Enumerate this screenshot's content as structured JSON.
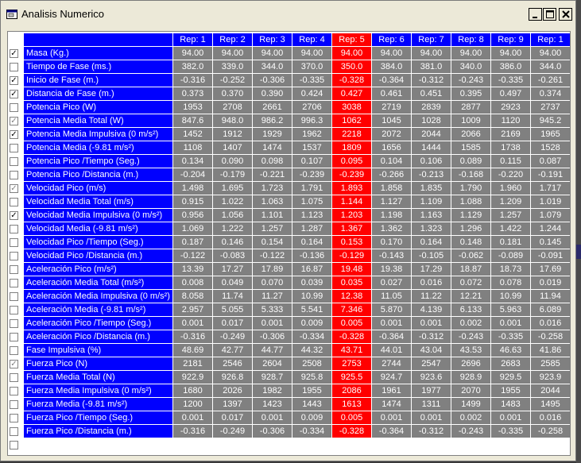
{
  "window": {
    "title": "Analisis Numerico"
  },
  "columns": [
    "Rep: 1",
    "Rep: 2",
    "Rep: 3",
    "Rep: 4",
    "Rep: 5",
    "Rep: 6",
    "Rep: 7",
    "Rep: 8",
    "Rep: 9",
    "Rep: 1"
  ],
  "selected_column": 4,
  "rows": [
    {
      "label": "Masa (Kg.)",
      "check": "checked",
      "values": [
        "94.00",
        "94.00",
        "94.00",
        "94.00",
        "94.00",
        "94.00",
        "94.00",
        "94.00",
        "94.00",
        "94.00"
      ]
    },
    {
      "label": "Tiempo de Fase (ms.)",
      "check": "unchecked",
      "values": [
        "382.0",
        "339.0",
        "344.0",
        "370.0",
        "350.0",
        "384.0",
        "381.0",
        "340.0",
        "386.0",
        "344.0"
      ]
    },
    {
      "label": "Inicio de Fase (m.)",
      "check": "checked",
      "values": [
        "-0.316",
        "-0.252",
        "-0.306",
        "-0.335",
        "-0.328",
        "-0.364",
        "-0.312",
        "-0.243",
        "-0.335",
        "-0.261"
      ]
    },
    {
      "label": "Distancia de Fase (m.)",
      "check": "checked",
      "values": [
        "0.373",
        "0.370",
        "0.390",
        "0.424",
        "0.427",
        "0.461",
        "0.451",
        "0.395",
        "0.497",
        "0.374"
      ]
    },
    {
      "label": "Potencia Pico (W)",
      "check": "unchecked",
      "values": [
        "1953",
        "2708",
        "2661",
        "2706",
        "3038",
        "2719",
        "2839",
        "2877",
        "2923",
        "2737"
      ]
    },
    {
      "label": "Potencia Media Total (W)",
      "check": "checked-gray",
      "values": [
        "847.6",
        "948.0",
        "986.2",
        "996.3",
        "1062",
        "1045",
        "1028",
        "1009",
        "1120",
        "945.2"
      ]
    },
    {
      "label": "Potencia Media Impulsiva (0 m/s²)",
      "check": "checked",
      "values": [
        "1452",
        "1912",
        "1929",
        "1962",
        "2218",
        "2072",
        "2044",
        "2066",
        "2169",
        "1965"
      ]
    },
    {
      "label": "Potencia Media (-9.81 m/s²)",
      "check": "unchecked",
      "values": [
        "1108",
        "1407",
        "1474",
        "1537",
        "1809",
        "1656",
        "1444",
        "1585",
        "1738",
        "1528"
      ]
    },
    {
      "label": "Potencia Pico /Tiempo (Seg.)",
      "check": "unchecked",
      "values": [
        "0.134",
        "0.090",
        "0.098",
        "0.107",
        "0.095",
        "0.104",
        "0.106",
        "0.089",
        "0.115",
        "0.087"
      ]
    },
    {
      "label": "Potencia Pico /Distancia (m.)",
      "check": "unchecked",
      "values": [
        "-0.204",
        "-0.179",
        "-0.221",
        "-0.239",
        "-0.239",
        "-0.266",
        "-0.213",
        "-0.168",
        "-0.220",
        "-0.191"
      ]
    },
    {
      "label": "Velocidad Pico (m/s)",
      "check": "checked-gray",
      "values": [
        "1.498",
        "1.695",
        "1.723",
        "1.791",
        "1.893",
        "1.858",
        "1.835",
        "1.790",
        "1.960",
        "1.717"
      ]
    },
    {
      "label": "Velocidad Media Total (m/s)",
      "check": "unchecked",
      "values": [
        "0.915",
        "1.022",
        "1.063",
        "1.075",
        "1.144",
        "1.127",
        "1.109",
        "1.088",
        "1.209",
        "1.019"
      ]
    },
    {
      "label": "Velocidad Media Impulsiva (0 m/s²)",
      "check": "checked",
      "values": [
        "0.956",
        "1.056",
        "1.101",
        "1.123",
        "1.203",
        "1.198",
        "1.163",
        "1.129",
        "1.257",
        "1.079"
      ]
    },
    {
      "label": "Velocidad Media (-9.81 m/s²)",
      "check": "unchecked",
      "values": [
        "1.069",
        "1.222",
        "1.257",
        "1.287",
        "1.367",
        "1.362",
        "1.323",
        "1.296",
        "1.422",
        "1.244"
      ]
    },
    {
      "label": "Velocidad Pico /Tiempo (Seg.)",
      "check": "unchecked",
      "values": [
        "0.187",
        "0.146",
        "0.154",
        "0.164",
        "0.153",
        "0.170",
        "0.164",
        "0.148",
        "0.181",
        "0.145"
      ]
    },
    {
      "label": "Velocidad Pico /Distancia (m.)",
      "check": "unchecked",
      "values": [
        "-0.122",
        "-0.083",
        "-0.122",
        "-0.136",
        "-0.129",
        "-0.143",
        "-0.105",
        "-0.062",
        "-0.089",
        "-0.091"
      ]
    },
    {
      "label": "Aceleración Pico (m/s²)",
      "check": "unchecked",
      "values": [
        "13.39",
        "17.27",
        "17.89",
        "16.87",
        "19.48",
        "19.38",
        "17.29",
        "18.87",
        "18.73",
        "17.69"
      ]
    },
    {
      "label": "Aceleración Media Total (m/s²)",
      "check": "unchecked",
      "values": [
        "0.008",
        "0.049",
        "0.070",
        "0.039",
        "0.035",
        "0.027",
        "0.016",
        "0.072",
        "0.078",
        "0.019"
      ]
    },
    {
      "label": "Aceleración Media Impulsiva (0 m/s²)",
      "check": "unchecked",
      "values": [
        "8.058",
        "11.74",
        "11.27",
        "10.99",
        "12.38",
        "11.05",
        "11.22",
        "12.21",
        "10.99",
        "11.94"
      ]
    },
    {
      "label": "Aceleración Media (-9.81 m/s²)",
      "check": "unchecked",
      "values": [
        "2.957",
        "5.055",
        "5.333",
        "5.541",
        "7.346",
        "5.870",
        "4.139",
        "6.133",
        "5.963",
        "6.089"
      ]
    },
    {
      "label": "Aceleración Pico /Tiempo (Seg.)",
      "check": "unchecked",
      "values": [
        "0.001",
        "0.017",
        "0.001",
        "0.009",
        "0.005",
        "0.001",
        "0.001",
        "0.002",
        "0.001",
        "0.016"
      ]
    },
    {
      "label": "Aceleración Pico /Distancia (m.)",
      "check": "unchecked",
      "values": [
        "-0.316",
        "-0.249",
        "-0.306",
        "-0.334",
        "-0.328",
        "-0.364",
        "-0.312",
        "-0.243",
        "-0.335",
        "-0.258"
      ]
    },
    {
      "label": "Fase Impulsiva (%)",
      "check": "unchecked",
      "values": [
        "48.69",
        "42.77",
        "44.77",
        "44.32",
        "43.71",
        "44.01",
        "43.04",
        "43.53",
        "46.63",
        "41.86"
      ]
    },
    {
      "label": "Fuerza Pico (N)",
      "check": "checked-gray",
      "values": [
        "2181",
        "2546",
        "2604",
        "2508",
        "2753",
        "2744",
        "2547",
        "2696",
        "2683",
        "2585"
      ]
    },
    {
      "label": "Fuerza Media Total (N)",
      "check": "unchecked",
      "values": [
        "922.9",
        "926.8",
        "928.7",
        "925.8",
        "925.5",
        "924.7",
        "923.6",
        "928.9",
        "929.5",
        "923.9"
      ]
    },
    {
      "label": "Fuerza Media Impulsiva (0 m/s²)",
      "check": "unchecked",
      "values": [
        "1680",
        "2026",
        "1982",
        "1955",
        "2086",
        "1961",
        "1977",
        "2070",
        "1955",
        "2044"
      ]
    },
    {
      "label": "Fuerza Media (-9.81 m/s²)",
      "check": "unchecked",
      "values": [
        "1200",
        "1397",
        "1423",
        "1443",
        "1613",
        "1474",
        "1311",
        "1499",
        "1483",
        "1495"
      ]
    },
    {
      "label": "Fuerza Pico /Tiempo (Seg.)",
      "check": "unchecked",
      "values": [
        "0.001",
        "0.017",
        "0.001",
        "0.009",
        "0.005",
        "0.001",
        "0.001",
        "0.002",
        "0.001",
        "0.016"
      ]
    },
    {
      "label": "Fuerza Pico /Distancia (m.)",
      "check": "unchecked",
      "values": [
        "-0.316",
        "-0.249",
        "-0.306",
        "-0.334",
        "-0.328",
        "-0.364",
        "-0.312",
        "-0.243",
        "-0.335",
        "-0.258"
      ]
    }
  ],
  "extra_row": {
    "check": "unchecked"
  },
  "colors": {
    "header_bg": "#0000ff",
    "cell_bg": "#808080",
    "selected_bg": "#ff0000",
    "text": "#ffffff"
  }
}
